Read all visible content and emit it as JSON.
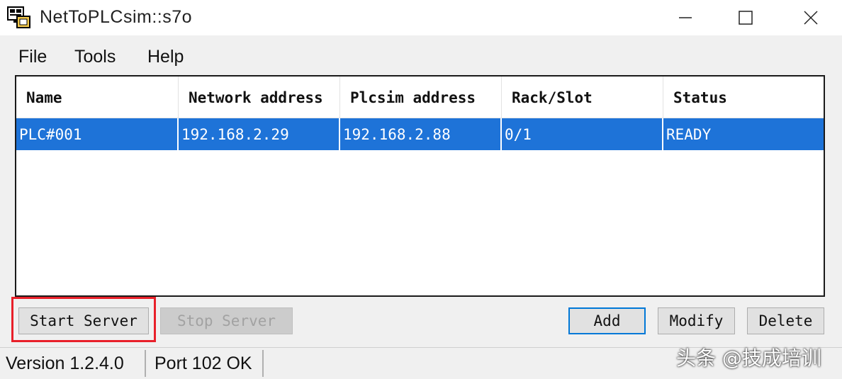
{
  "window": {
    "title": "NetToPLCsim::s7o",
    "icon": "app-monitor-icon"
  },
  "menu": [
    "File",
    "Tools",
    "Help"
  ],
  "table": {
    "columns": [
      "Name",
      "Network address",
      "Plcsim address",
      "Rack/Slot",
      "Status"
    ],
    "rows": [
      [
        "PLC#001",
        "192.168.2.29",
        "192.168.2.88",
        "0/1",
        "READY"
      ]
    ],
    "selected_row": 0,
    "selection_color": "#1e73d8"
  },
  "buttons": {
    "start_server": "Start Server",
    "stop_server": "Stop Server",
    "add": "Add",
    "modify": "Modify",
    "delete": "Delete"
  },
  "status": {
    "version": "Version 1.2.4.0",
    "port": "Port 102 OK"
  },
  "watermark": "头条 @技成培训",
  "colors": {
    "highlight": "#e8202a",
    "default_button_border": "#0078d7"
  }
}
